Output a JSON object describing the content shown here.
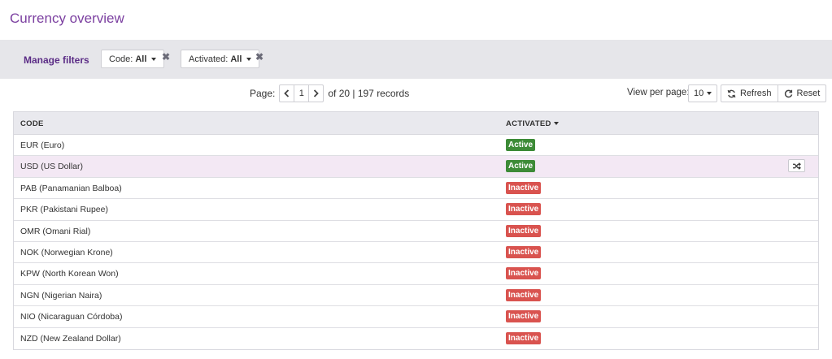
{
  "page": {
    "title": "Currency overview"
  },
  "filters": {
    "manage_label": "Manage filters",
    "code": {
      "label": "Code:",
      "value": "All"
    },
    "activated": {
      "label": "Activated:",
      "value": "All"
    }
  },
  "pager": {
    "label": "Page:",
    "current": "1",
    "info": "of 20 | 197 records"
  },
  "toolbar": {
    "per_page_label": "View per page:",
    "per_page_value": "10",
    "refresh_label": "Refresh",
    "reset_label": "Reset"
  },
  "table": {
    "columns": {
      "code": "CODE",
      "activated": "ACTIVATED"
    },
    "rows": [
      {
        "code": "EUR (Euro)",
        "status": "Active"
      },
      {
        "code": "USD (US Dollar)",
        "status": "Active"
      },
      {
        "code": "PAB (Panamanian Balboa)",
        "status": "Inactive"
      },
      {
        "code": "PKR (Pakistani Rupee)",
        "status": "Inactive"
      },
      {
        "code": "OMR (Omani Rial)",
        "status": "Inactive"
      },
      {
        "code": "NOK (Norwegian Krone)",
        "status": "Inactive"
      },
      {
        "code": "KPW (North Korean Won)",
        "status": "Inactive"
      },
      {
        "code": "NGN (Nigerian Naira)",
        "status": "Inactive"
      },
      {
        "code": "NIO (Nicaraguan Córdoba)",
        "status": "Inactive"
      },
      {
        "code": "NZD (New Zealand Dollar)",
        "status": "Inactive"
      }
    ]
  },
  "colors": {
    "accent": "#7b3fa0",
    "active": "#3d8b37",
    "inactive": "#d9534f",
    "highlight_row": "#f3e8f4"
  },
  "icons": {
    "prev": "chevron-left-icon",
    "next": "chevron-right-icon",
    "clear": "close-icon",
    "refresh": "refresh-icon",
    "reset": "reset-icon",
    "row_action": "shuffle-icon"
  }
}
